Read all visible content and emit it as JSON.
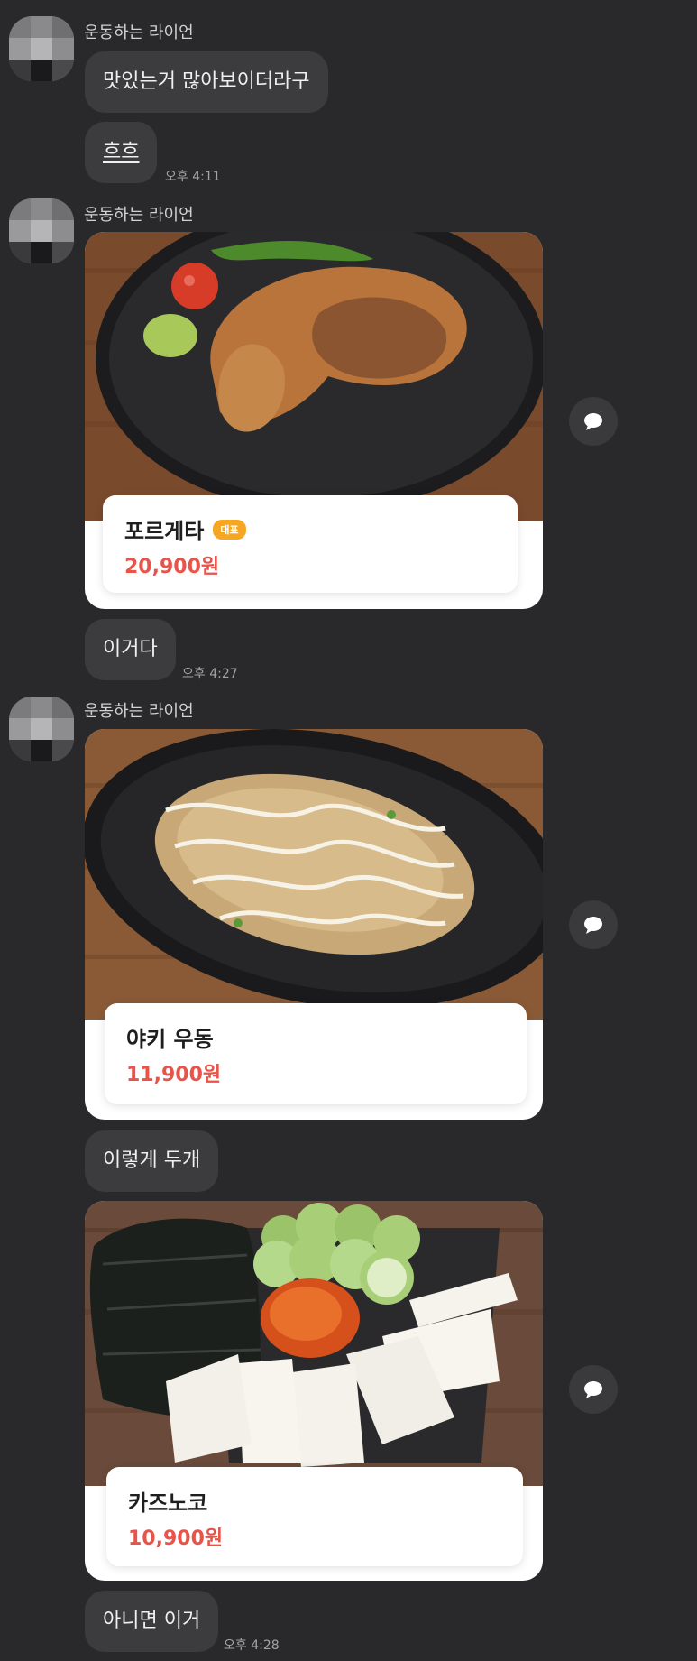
{
  "messages": {
    "group1": {
      "sender": "운동하는 라이언",
      "bubble1": "맛있는거 많아보이더라구",
      "bubble2": "흐흐",
      "time": "오후 4:11"
    },
    "group2": {
      "sender": "운동하는 라이언",
      "card": {
        "name": "포르게타",
        "badge": "대표",
        "price": "20,900원"
      },
      "bubble": "이거다",
      "time": "오후 4:27"
    },
    "group3": {
      "sender": "운동하는 라이언",
      "card1": {
        "name": "야키 우동",
        "price": "11,900원"
      },
      "bubble1": "이렇게 두개",
      "card2": {
        "name": "카즈노코",
        "price": "10,900원"
      },
      "bubble2": "아니면 이거",
      "time": "오후 4:28"
    }
  },
  "icons": {
    "avatar": "pixelated-avatar",
    "share": "speech-bubble-icon"
  },
  "colors": {
    "background": "#29292b",
    "bubble": "#3c3c3e",
    "price": "#e8534a",
    "badge": "#f5a623"
  }
}
